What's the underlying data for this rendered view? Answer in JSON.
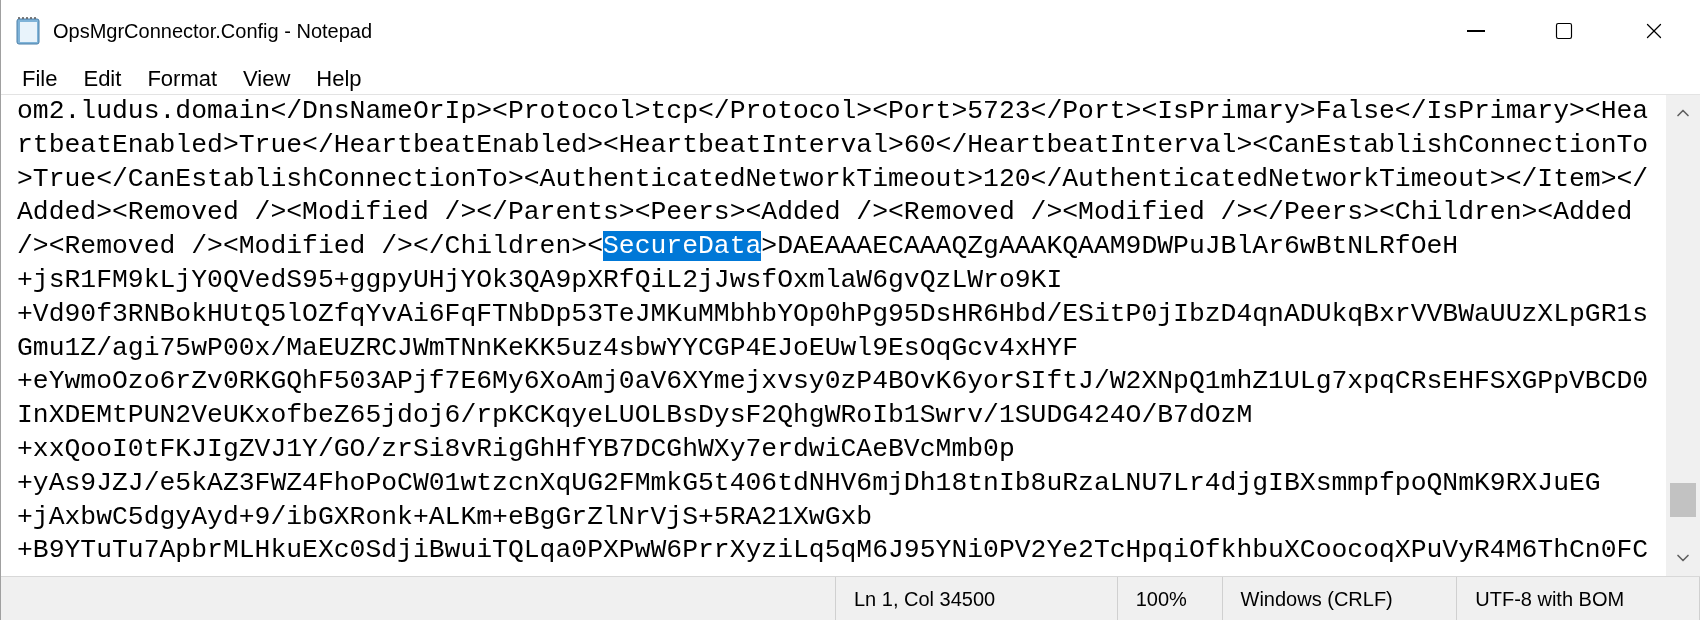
{
  "window": {
    "title": "OpsMgrConnector.Config - Notepad"
  },
  "menu": [
    "File",
    "Edit",
    "Format",
    "View",
    "Help"
  ],
  "editor": {
    "lines": [
      {
        "segments": [
          {
            "text": "om2.ludus.domain</DnsNameOrIp><Protocol>tcp</Protocol><Port>5723</Port><IsPrimary>False</IsPrimary><Hea",
            "selected": false
          }
        ]
      },
      {
        "segments": [
          {
            "text": "rtbeatEnabled>True</HeartbeatEnabled><HeartbeatInterval>60</HeartbeatInterval><CanEstablishConnectionTo",
            "selected": false
          }
        ]
      },
      {
        "segments": [
          {
            "text": ">True</CanEstablishConnectionTo><AuthenticatedNetworkTimeout>120</AuthenticatedNetworkTimeout></Item></",
            "selected": false
          }
        ]
      },
      {
        "segments": [
          {
            "text": "Added><Removed /><Modified /></Parents><Peers><Added /><Removed /><Modified /></Peers><Children><Added",
            "selected": false
          }
        ]
      },
      {
        "segments": [
          {
            "text": "/><Removed /><Modified /></Children><",
            "selected": false
          },
          {
            "text": "SecureData",
            "selected": true
          },
          {
            "text": ">DAEAAAECAAAQZgAAAKQAAM9DWPuJBlAr6wBtNLRfOeH",
            "selected": false
          }
        ]
      },
      {
        "segments": [
          {
            "text": "+jsR1FM9kLjY0QVedS95+ggpyUHjYOk3QA9pXRfQiL2jJwsfOxmlaW6gvQzLWro9KI",
            "selected": false
          }
        ]
      },
      {
        "segments": [
          {
            "text": "+Vd90f3RNBokHUtQ5lOZfqYvAi6FqFTNbDp53TeJMKuMMbhbYOp0hPg95DsHR6Hbd/ESitP0jIbzD4qnADUkqBxrVVBWaUUzXLpGR1s",
            "selected": false
          }
        ]
      },
      {
        "segments": [
          {
            "text": "Gmu1Z/agi75wP00x/MaEUZRCJWmTNnKeKK5uz4sbwYYCGP4EJoEUwl9EsOqGcv4xHYF",
            "selected": false
          }
        ]
      },
      {
        "segments": [
          {
            "text": "+eYwmoOzo6rZv0RKGQhF503APjf7E6My6XoAmj0aV6XYmejxvsy0zP4BOvK6yorSIftJ/W2XNpQ1mhZ1ULg7xpqCRsEHFSXGPpVBCD0",
            "selected": false
          }
        ]
      },
      {
        "segments": [
          {
            "text": "InXDEMtPUN2VeUKxofbeZ65jdoj6/rpKCKqyeLUOLBsDysF2QhgWRoIb1Swrv/1SUDG424O/B7dOzM",
            "selected": false
          }
        ]
      },
      {
        "segments": [
          {
            "text": "+xxQooI0tFKJIgZVJ1Y/GO/zrSi8vRigGhHfYB7DCGhWXy7erdwiCAeBVcMmb0p",
            "selected": false
          }
        ]
      },
      {
        "segments": [
          {
            "text": "+yAs9JZJ/e5kAZ3FWZ4FhoPoCW01wtzcnXqUG2FMmkG5t406tdNHV6mjDh18tnIb8uRzaLNU7Lr4djgIBXsmmpfpoQNmK9RXJuEG",
            "selected": false
          }
        ]
      },
      {
        "segments": [
          {
            "text": "+jAxbwC5dgyAyd+9/ibGXRonk+ALKm+eBgGrZlNrVjS+5RA21XwGxb",
            "selected": false
          }
        ]
      },
      {
        "segments": [
          {
            "text": "+B9YTuTu7ApbrMLHkuEXc0SdjiBwuiTQLqa0PXPwW6PrrXyziLq5qM6J95YNi0PV2Ye2TcHpqiOfkhbuXCoocoqXPuVyR4M6ThCn0FC",
            "selected": false
          }
        ]
      }
    ]
  },
  "status_bar": [
    "Ln 1, Col 34500",
    "100%",
    "Windows (CRLF)",
    "UTF-8 with BOM"
  ]
}
